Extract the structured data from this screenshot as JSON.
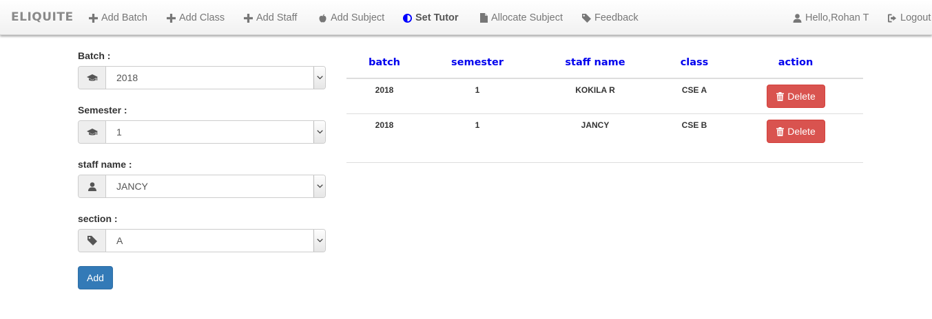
{
  "nav": {
    "brand": "ELIQUITE",
    "items": [
      {
        "label": "Add Batch",
        "icon": "plus-icon"
      },
      {
        "label": "Add Class",
        "icon": "plus-icon"
      },
      {
        "label": "Add Staff",
        "icon": "plus-icon"
      },
      {
        "label": "Add Subject",
        "icon": "apple-icon"
      },
      {
        "label": "Set Tutor",
        "icon": "adjust-icon",
        "active": true
      },
      {
        "label": "Allocate Subject",
        "icon": "file-icon"
      },
      {
        "label": "Feedback",
        "icon": "tag-icon"
      }
    ],
    "user": {
      "label": "Hello,Rohan T",
      "icon": "user-icon"
    },
    "logout": {
      "label": "Logout",
      "icon": "logout-icon"
    }
  },
  "form": {
    "batch": {
      "label": "Batch :",
      "value": "2018",
      "icon": "graduation-cap-icon"
    },
    "semester": {
      "label": "Semester :",
      "value": "1",
      "icon": "graduation-cap-icon"
    },
    "staff": {
      "label": "staff name :",
      "value": "JANCY",
      "icon": "user-icon"
    },
    "section": {
      "label": "section :",
      "value": "A",
      "icon": "tag-icon"
    },
    "add_button": "Add"
  },
  "table": {
    "headers": [
      "batch",
      "semester",
      "staff name",
      "class",
      "action"
    ],
    "rows": [
      {
        "batch": "2018",
        "semester": "1",
        "staff": "KOKILA R",
        "class": "CSE A",
        "action": "Delete"
      },
      {
        "batch": "2018",
        "semester": "1",
        "staff": "JANCY",
        "class": "CSE B",
        "action": "Delete"
      }
    ]
  },
  "colors": {
    "accent": "#337ab7",
    "header_text": "#0000ee",
    "danger": "#d9534f",
    "active_icon": "#0000ff"
  }
}
